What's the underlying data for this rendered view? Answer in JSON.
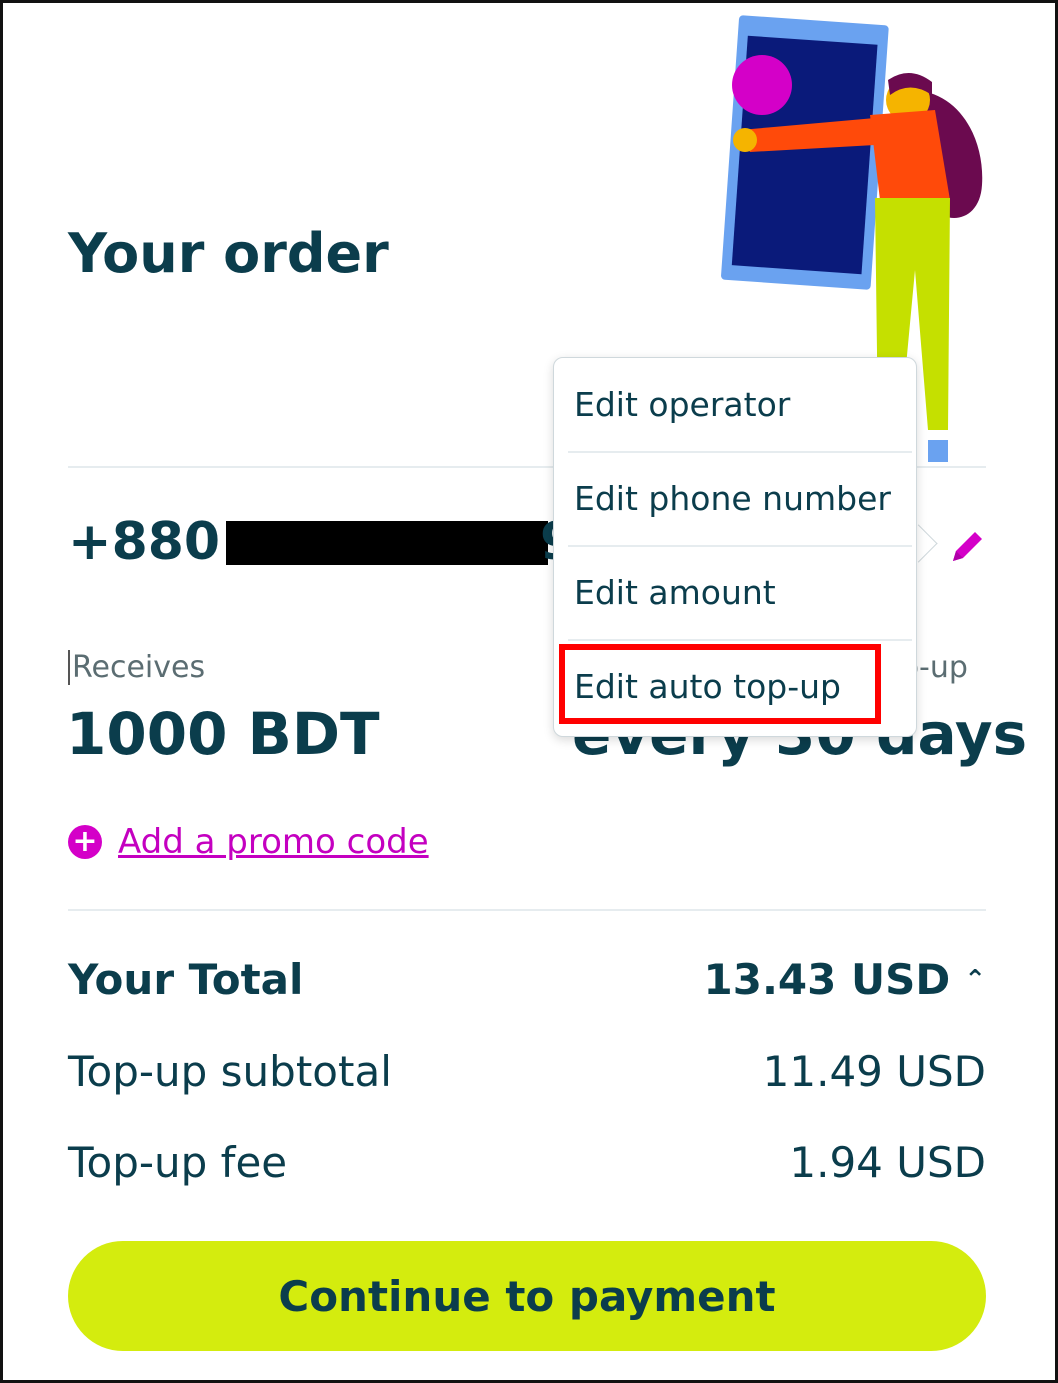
{
  "order": {
    "title": "Your order",
    "phone_prefix": "+880 1",
    "phone_suffix": "9",
    "receives_label": "Receives",
    "receives_value": "1000 BDT",
    "auto_topup_label": "p-up",
    "auto_topup_value": "every 30 days",
    "promo_label": "Add a promo code"
  },
  "summary": {
    "total_label": "Your Total",
    "total_value": "13.43 USD",
    "subtotal_label": "Top-up subtotal",
    "subtotal_value": "11.49 USD",
    "fee_label": "Top-up fee",
    "fee_value": "1.94 USD"
  },
  "menu": {
    "items": [
      {
        "label": "Edit operator"
      },
      {
        "label": "Edit phone number"
      },
      {
        "label": "Edit amount"
      },
      {
        "label": "Edit auto top-up"
      }
    ]
  },
  "cta": {
    "label": "Continue to payment"
  },
  "icons": {
    "edit": "pencil-icon",
    "promo": "plus-circle-icon",
    "total_toggle": "chevron-up-icon"
  },
  "colors": {
    "primary_text": "#0b3d4c",
    "accent_magenta": "#d400c8",
    "cta_background": "#d4ec0e",
    "highlight": "#ff0000"
  }
}
